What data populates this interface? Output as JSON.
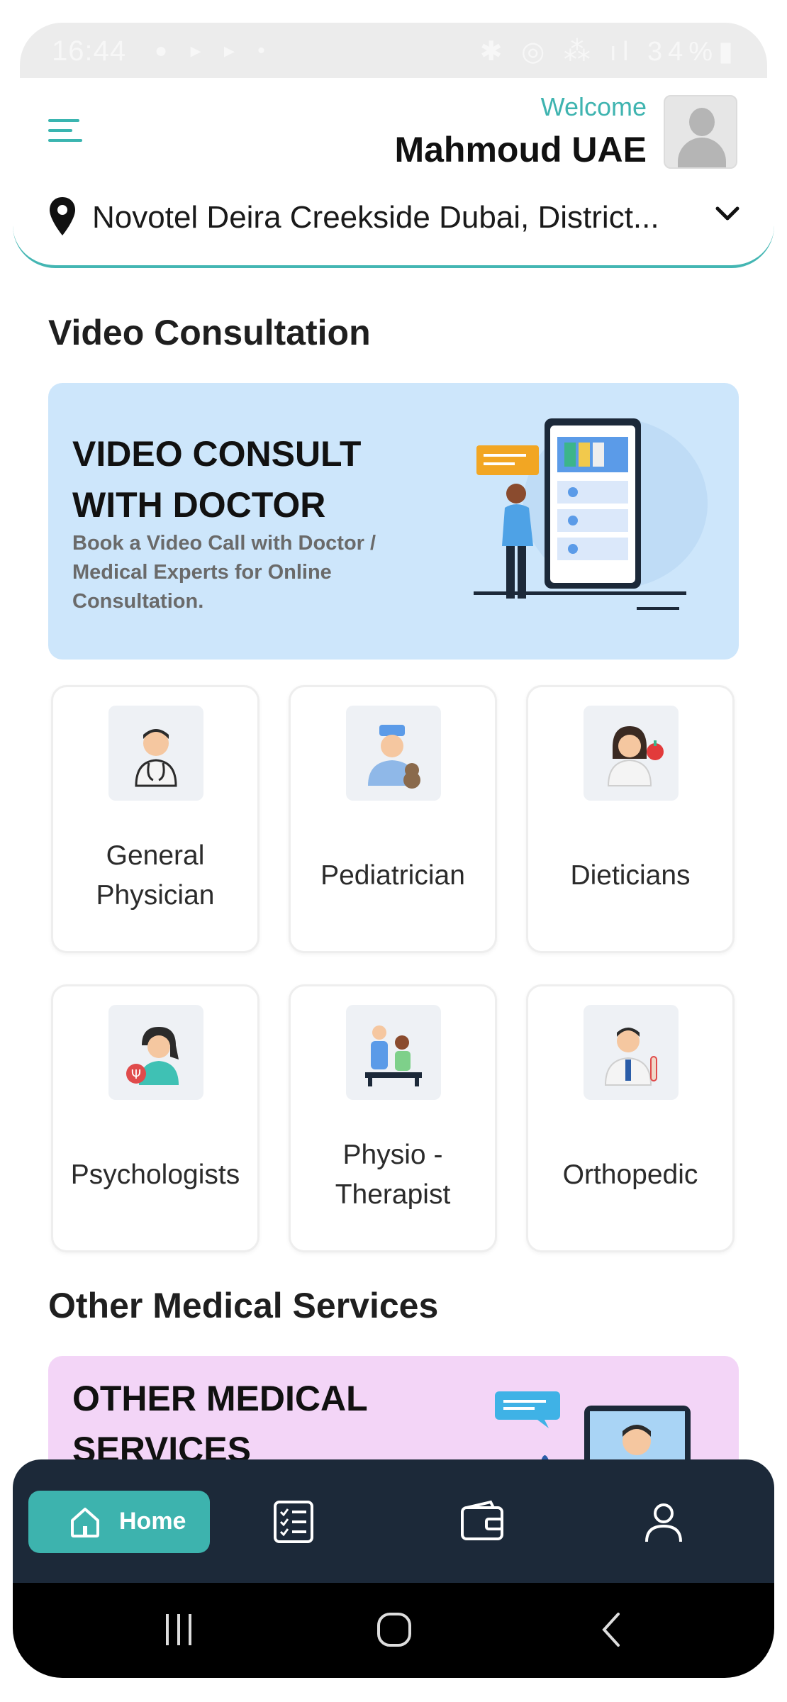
{
  "status_bar": {
    "time": "16:44",
    "battery": "34%"
  },
  "header": {
    "welcome": "Welcome",
    "username": "Mahmoud UAE",
    "location": "Novotel Deira Creekside Dubai, District..."
  },
  "video_section": {
    "title": "Video Consultation",
    "banner_title_line1": "VIDEO CONSULT",
    "banner_title_line2": "WITH DOCTOR",
    "banner_desc_line1": "Book a Video Call with Doctor /",
    "banner_desc_line2": "Medical Experts for Online",
    "banner_desc_line3": "Consultation."
  },
  "specialties": [
    {
      "label_line1": "General",
      "label_line2": "Physician",
      "icon": "doctor-icon"
    },
    {
      "label_line1": "Pediatrician",
      "label_line2": "",
      "icon": "pediatrician-icon"
    },
    {
      "label_line1": "Dieticians",
      "label_line2": "",
      "icon": "dietician-icon"
    },
    {
      "label_line1": "Psychologists",
      "label_line2": "",
      "icon": "psychologist-icon"
    },
    {
      "label_line1": "Physio -",
      "label_line2": "Therapist",
      "icon": "physiotherapist-icon"
    },
    {
      "label_line1": "Orthopedic",
      "label_line2": "",
      "icon": "orthopedic-icon"
    }
  ],
  "other_section": {
    "title": "Other Medical Services",
    "banner_title_line1": "OTHER MEDICAL",
    "banner_title_line2": "SERVICES"
  },
  "bottom_nav": {
    "home": "Home",
    "items": [
      "home-icon",
      "checklist-icon",
      "wallet-icon",
      "profile-icon"
    ]
  },
  "colors": {
    "accent": "#3db3ae",
    "nav_bg": "#1c2939",
    "video_banner": "#cde6fb",
    "other_banner": "#f3d5f7"
  }
}
